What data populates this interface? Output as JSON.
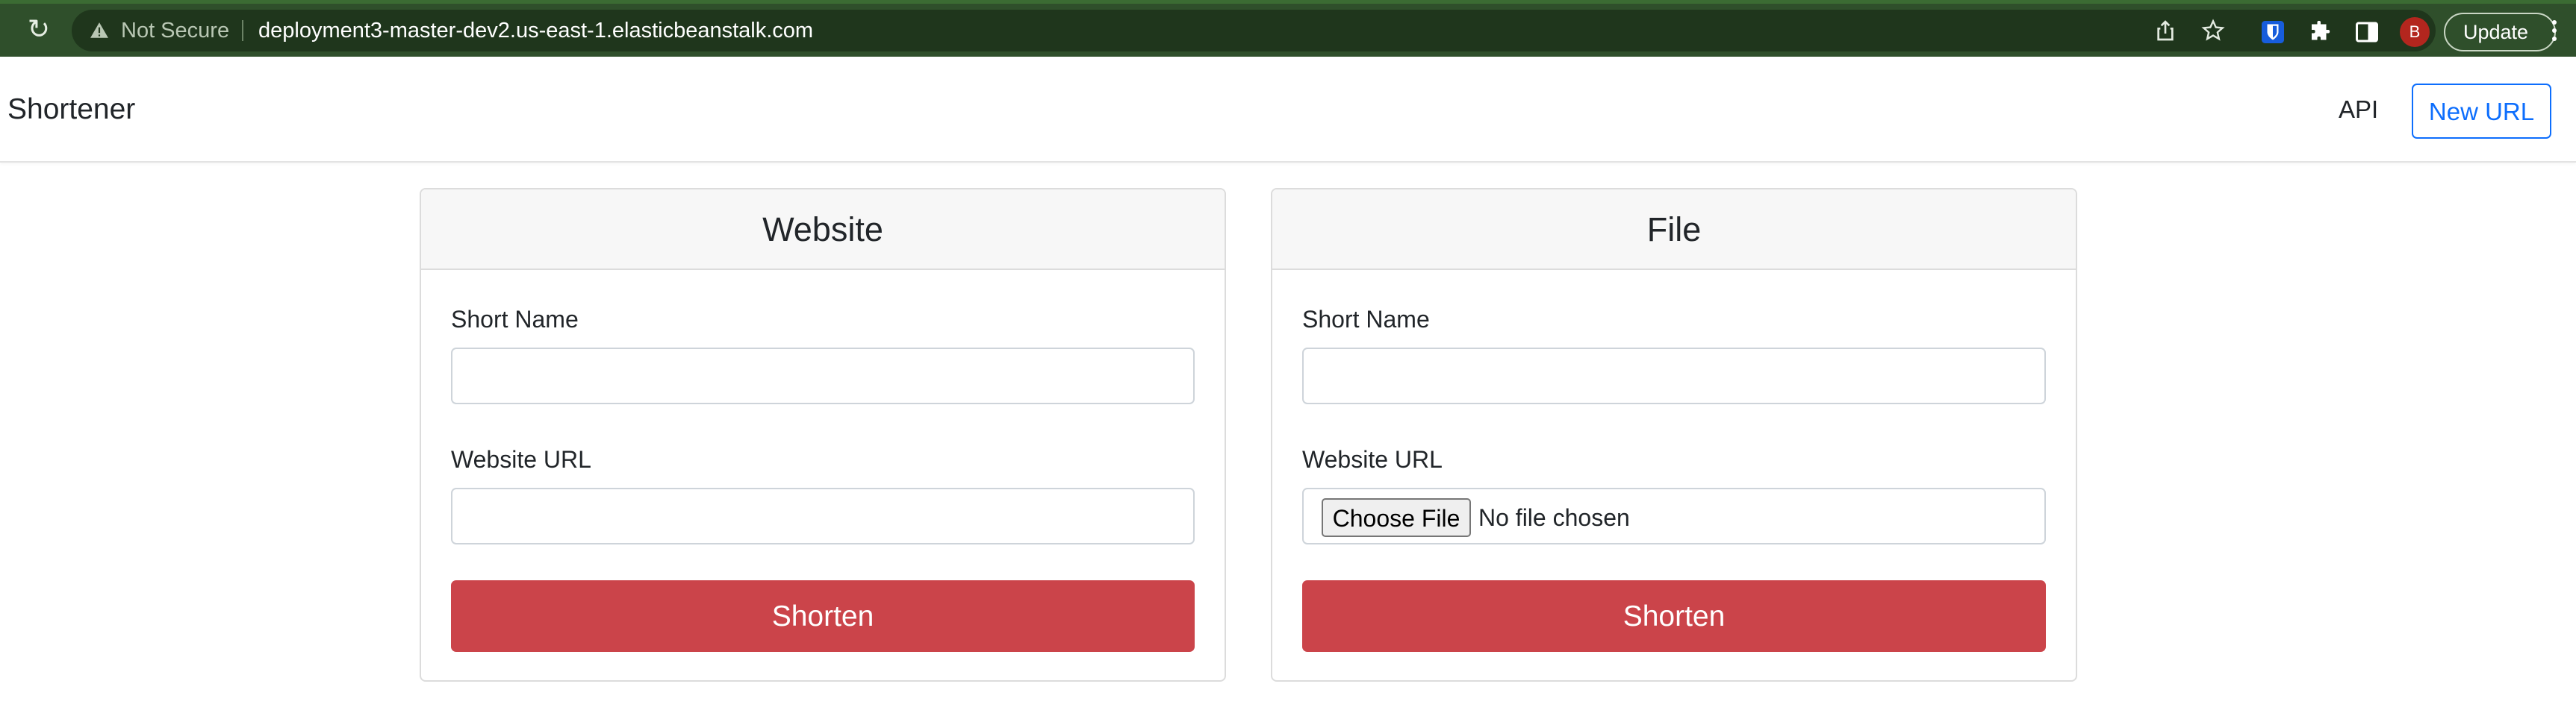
{
  "browser": {
    "security_label": "Not Secure",
    "url": "deployment3-master-dev2.us-east-1.elasticbeanstalk.com",
    "profile_initial": "B",
    "update_label": "Update",
    "theme_color": "#2f4f2b"
  },
  "navbar": {
    "brand": "Shortener",
    "api_link": "API",
    "new_url_button": "New URL",
    "accent_color": "#0d6efd"
  },
  "website_card": {
    "title": "Website",
    "short_name_label": "Short Name",
    "short_name_value": "",
    "url_label": "Website URL",
    "url_value": "",
    "submit_label": "Shorten"
  },
  "file_card": {
    "title": "File",
    "short_name_label": "Short Name",
    "short_name_value": "",
    "url_label": "Website URL",
    "choose_file_label": "Choose File",
    "file_status": "No file chosen",
    "submit_label": "Shorten"
  },
  "colors": {
    "submit_button": "#cb444a"
  }
}
